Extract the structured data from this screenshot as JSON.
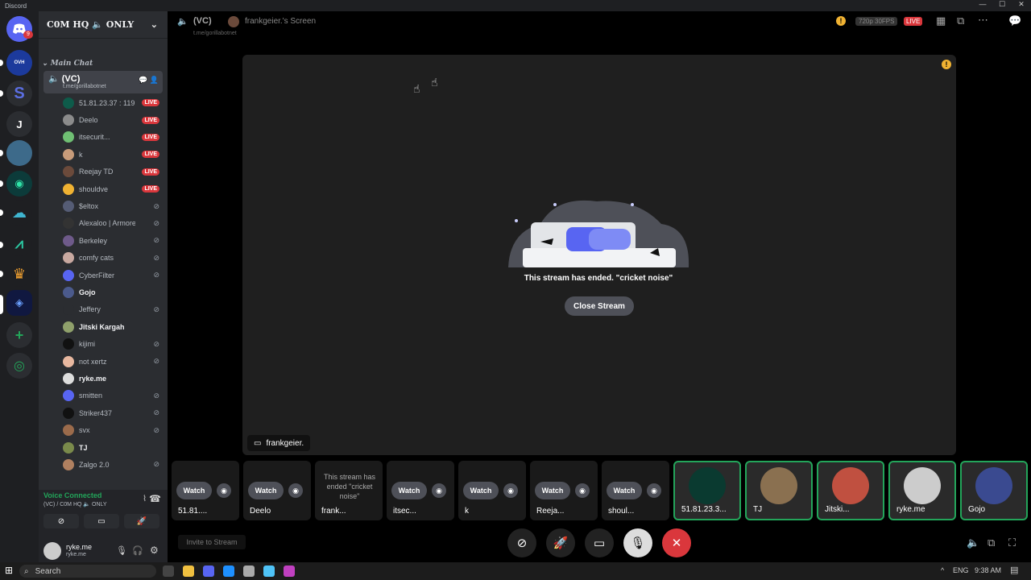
{
  "app": {
    "title": "Discord"
  },
  "server": {
    "name": "C0M HQ 🔈 ONLY",
    "guild_badge": "9",
    "j_label": "J"
  },
  "category": "Main Chat",
  "voice_channel": {
    "name": "(VC)",
    "subtitle": "t.me/gorillabotnet"
  },
  "members": [
    {
      "name": "51.81.23.37 : 119...",
      "live": true,
      "color": "#0e5b4a"
    },
    {
      "name": "Deelo",
      "live": true,
      "color": "#8b8b8b"
    },
    {
      "name": "itsecurit...",
      "live": true,
      "color": "#6fbf73"
    },
    {
      "name": "k",
      "live": true,
      "color": "#c79b7a"
    },
    {
      "name": "Reejay TD",
      "live": true,
      "color": "#6b4a3b"
    },
    {
      "name": "shouldve",
      "live": true,
      "color": "#f0b232"
    },
    {
      "name": "$eltox",
      "live": false,
      "color": "#555c75"
    },
    {
      "name": "Alexaloo | Armored...",
      "live": false,
      "color": "#333"
    },
    {
      "name": "Berkeley",
      "live": false,
      "color": "#6e5a8a"
    },
    {
      "name": "comfy cats",
      "live": false,
      "color": "#c8a8a0"
    },
    {
      "name": "CyberFilter",
      "live": false,
      "color": "#5865f2"
    },
    {
      "name": "Gojo",
      "live": false,
      "color": "#4b5a8c",
      "bright": true
    },
    {
      "name": "Jeffery",
      "live": false,
      "color": "#2b2d31"
    },
    {
      "name": "Jitski Kargah",
      "live": false,
      "color": "#8fa06b",
      "bright": true
    },
    {
      "name": "kijimi",
      "live": false,
      "color": "#111"
    },
    {
      "name": "not xertz",
      "live": false,
      "color": "#e8b8a0"
    },
    {
      "name": "ryke.me",
      "live": false,
      "color": "#ddd",
      "bright": true
    },
    {
      "name": "smitten",
      "live": false,
      "color": "#5865f2"
    },
    {
      "name": "Striker437",
      "live": false,
      "color": "#111"
    },
    {
      "name": "svx",
      "live": false,
      "color": "#9b6b4b"
    },
    {
      "name": "TJ",
      "live": false,
      "color": "#7a8a4b",
      "bright": true
    },
    {
      "name": "Zalgo 2.0",
      "live": false,
      "color": "#b08060"
    }
  ],
  "live_label": "LIVE",
  "voice_status": {
    "title": "Voice Connected",
    "subtitle": "(VC) / C0M HQ 🔈 ONLY"
  },
  "user": {
    "name": "ryke.me",
    "status": "ryke.me"
  },
  "topbar": {
    "channel": "(VC)",
    "channel_sub": "t.me/gorillabotnet",
    "screen_title": "frankgeier.'s Screen",
    "quality": "720p 30FPS",
    "live": "LIVE"
  },
  "stage": {
    "ended_text": "This stream has ended. \"cricket noise\"",
    "close_label": "Close Stream",
    "owner": "frankgeier."
  },
  "tiles": [
    {
      "label": "51.81....",
      "watch": "Watch"
    },
    {
      "label": "Deelo",
      "watch": "Watch"
    },
    {
      "label": "frank...",
      "watch": "",
      "ended": "This stream has ended \"cricket noise\""
    },
    {
      "label": "itsec...",
      "watch": "Watch"
    },
    {
      "label": "k",
      "watch": "Watch"
    },
    {
      "label": "Reeja...",
      "watch": "Watch"
    },
    {
      "label": "shoul...",
      "watch": "Watch"
    }
  ],
  "user_tiles": [
    {
      "label": "51.81.23.3...",
      "color": "#0a3a30"
    },
    {
      "label": "TJ",
      "color": "#8a7050"
    },
    {
      "label": "Jitski...",
      "color": "#c05040"
    },
    {
      "label": "ryke.me",
      "color": "#ccc"
    },
    {
      "label": "Gojo",
      "color": "#3a4a90"
    }
  ],
  "invite": "Invite to Stream",
  "taskbar": {
    "search": "Search",
    "lang": "ENG",
    "time": "9:38 AM"
  }
}
